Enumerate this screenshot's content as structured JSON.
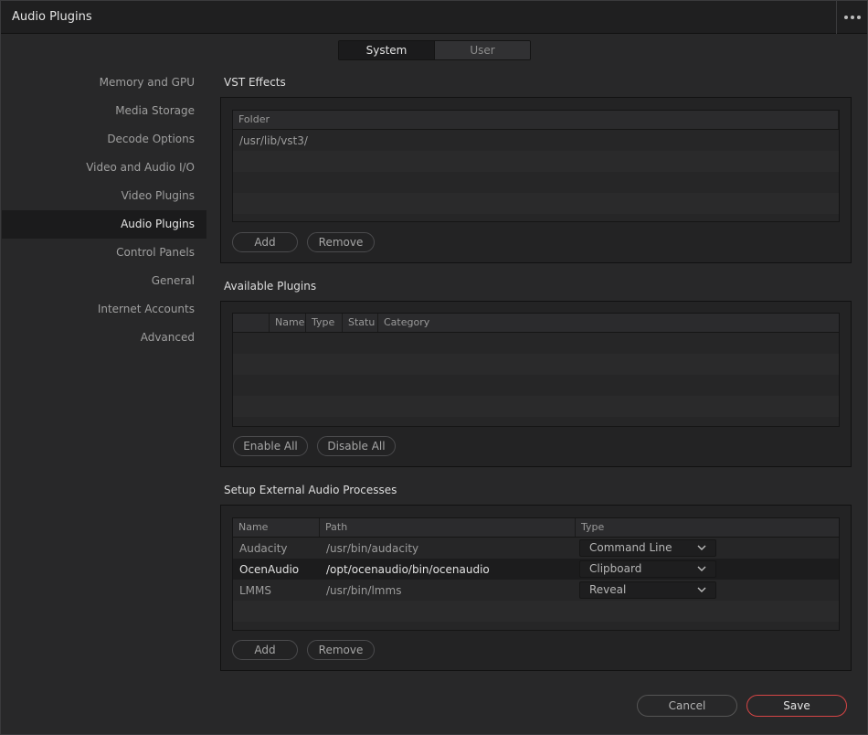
{
  "window": {
    "title": "Audio Plugins",
    "more_icon": "more-horizontal-icon"
  },
  "tabs": {
    "system": "System",
    "user": "User"
  },
  "sidebar": {
    "items": [
      {
        "label": "Memory and GPU"
      },
      {
        "label": "Media Storage"
      },
      {
        "label": "Decode Options"
      },
      {
        "label": "Video and Audio I/O"
      },
      {
        "label": "Video Plugins"
      },
      {
        "label": "Audio Plugins"
      },
      {
        "label": "Control Panels"
      },
      {
        "label": "General"
      },
      {
        "label": "Internet Accounts"
      },
      {
        "label": "Advanced"
      }
    ],
    "active": "Audio Plugins"
  },
  "vst": {
    "title": "VST Effects",
    "header": "Folder",
    "rows": [
      "/usr/lib/vst3/"
    ],
    "add": "Add",
    "remove": "Remove"
  },
  "available": {
    "title": "Available Plugins",
    "headers": [
      "",
      "Name",
      "Type",
      "Statu",
      "Category"
    ],
    "enable_all": "Enable All",
    "disable_all": "Disable All"
  },
  "external": {
    "title": "Setup External Audio Processes",
    "headers": [
      "Name",
      "Path",
      "Type"
    ],
    "rows": [
      {
        "name": "Audacity",
        "path": "/usr/bin/audacity",
        "type": "Command Line"
      },
      {
        "name": "OcenAudio",
        "path": "/opt/ocenaudio/bin/ocenaudio",
        "type": "Clipboard"
      },
      {
        "name": "LMMS",
        "path": "/usr/bin/lmms",
        "type": "Reveal"
      }
    ],
    "add": "Add",
    "remove": "Remove"
  },
  "footer": {
    "cancel": "Cancel",
    "save": "Save"
  },
  "colors": {
    "accent": "#d64545",
    "background": "#282829",
    "selection": "#1b1b1c"
  }
}
